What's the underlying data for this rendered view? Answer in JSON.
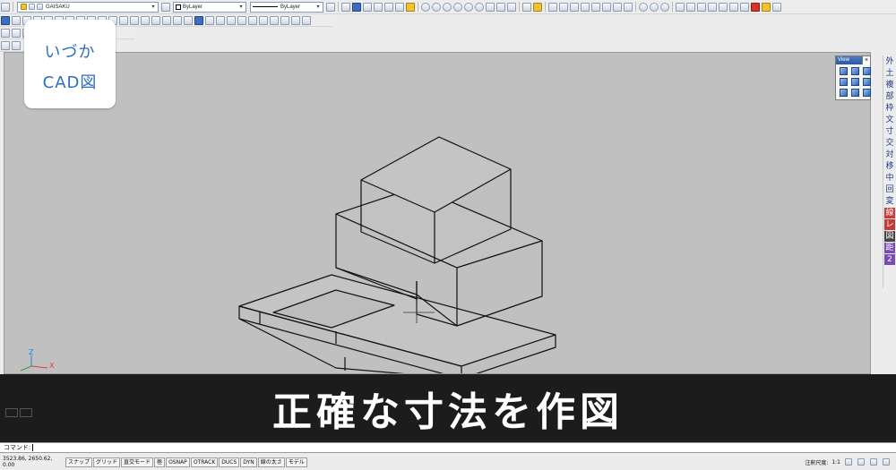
{
  "toolbar": {
    "layer_name": "GAISAKU",
    "color_value": "ByLayer",
    "linetype_value": "ByLayer"
  },
  "logo": {
    "line1": "いづか",
    "line2": "CAD図"
  },
  "view_panel": {
    "title": "View"
  },
  "right_toolbar": {
    "buttons": [
      "外",
      "土",
      "複",
      "部",
      "枠",
      "文",
      "寸",
      "交",
      "対",
      "移",
      "中",
      "回",
      "変",
      "線",
      "レ",
      "図",
      "距",
      "2"
    ]
  },
  "caption": {
    "text": "正確な寸法を作図"
  },
  "command": {
    "prompt": "コマンド:"
  },
  "status": {
    "coords": "3523.86, 2650.62, 0.00",
    "toggles": [
      "スナップ",
      "グリッド",
      "直交モード",
      "極",
      "OSNAP",
      "OTRACK",
      "DUCS",
      "DYN",
      "線の太さ",
      "モデル"
    ],
    "annotation_scale_label": "注釈尺度:",
    "annotation_scale_value": "1:1"
  },
  "colors": {
    "canvas_bg": "#c0c0c0",
    "caption_bg": "#1c1c1c",
    "logo_text": "#2f6ebb"
  }
}
